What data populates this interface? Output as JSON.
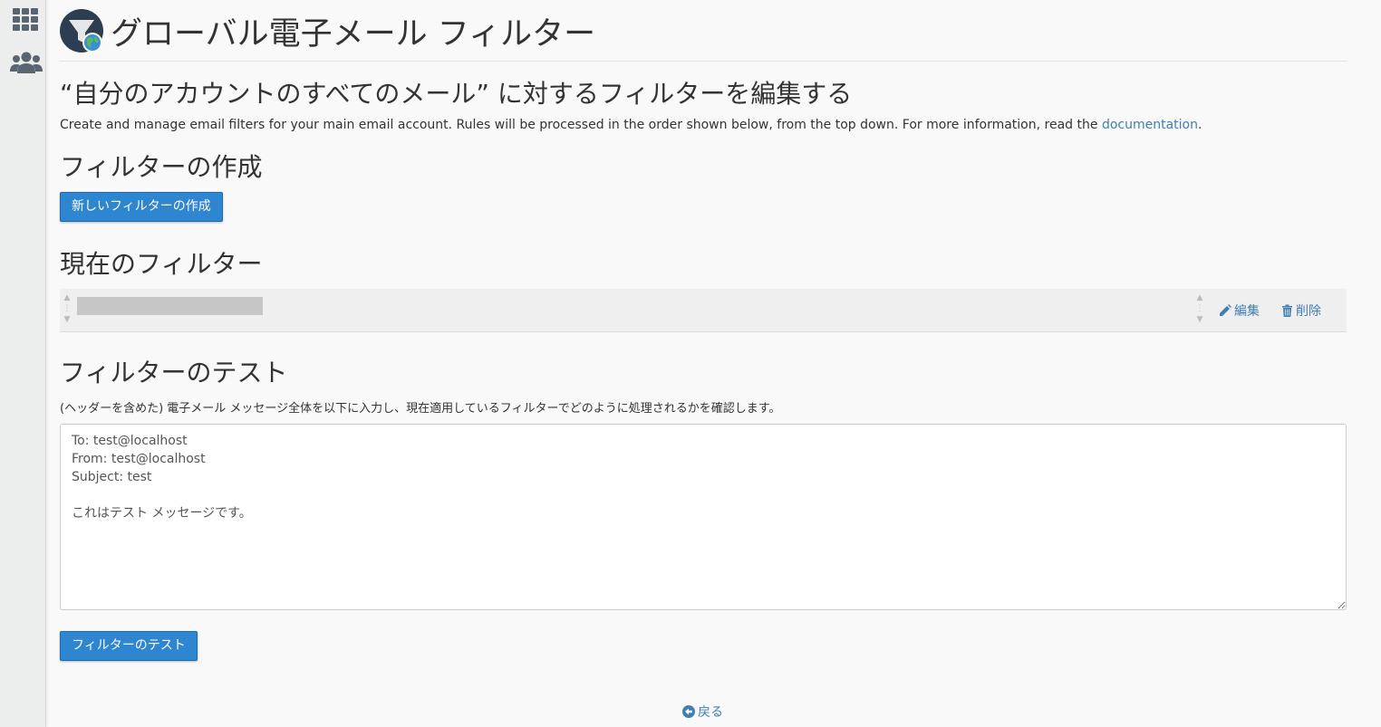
{
  "page": {
    "title": "グローバル電子メール フィルター",
    "subtitle": "“自分のアカウントのすべてのメール” に対するフィルターを編集する",
    "description_prefix": "Create and manage email filters for your main email account. Rules will be processed in the order shown below, from the top down. For more information, read the ",
    "description_link": "documentation",
    "description_suffix": "."
  },
  "create_section": {
    "heading": "フィルターの作成",
    "button_label": "新しいフィルターの作成"
  },
  "current_section": {
    "heading": "現在のフィルター",
    "filters": [
      {
        "name": "",
        "edit_label": "編集",
        "delete_label": "削除"
      }
    ]
  },
  "test_section": {
    "heading": "フィルターのテスト",
    "instructions": "(ヘッダーを含めた) 電子メール メッセージ全体を以下に入力し、現在適用しているフィルターでどのように処理されるかを確認します。",
    "message": "To: test@localhost\nFrom: test@localhost\nSubject: test\n\nこれはテスト メッセージです。",
    "button_label": "フィルターのテスト"
  },
  "footer": {
    "back_label": "戻る"
  },
  "colors": {
    "accent": "#2f86d0",
    "link": "#3f7fb3",
    "logo_bg": "#2d3e50"
  },
  "icons": {
    "sidebar": [
      "grid-icon",
      "users-icon"
    ],
    "logo": "filter-globe-icon",
    "edit": "pencil-icon",
    "delete": "trash-icon",
    "back": "arrow-left-circle-icon"
  }
}
